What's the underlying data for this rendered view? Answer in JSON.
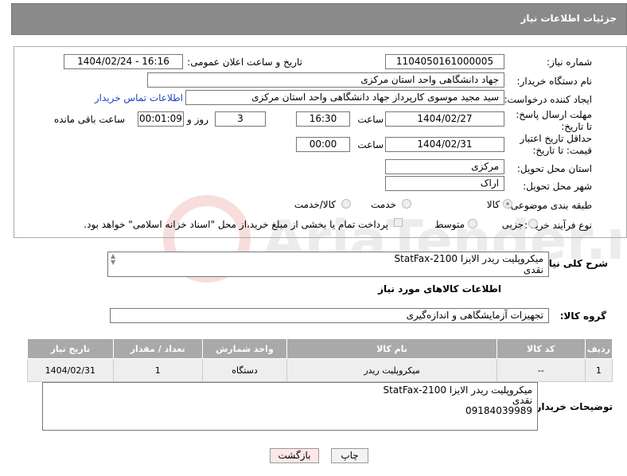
{
  "header": {
    "title": "جزئیات اطلاعات نیاز"
  },
  "form": {
    "need_number_label": "شماره نیاز:",
    "need_number": "1104050161000005",
    "announce_label": "تاریخ و ساعت اعلان عمومی:",
    "announce_value": "1404/02/24 - 16:16",
    "buyer_org_label": "نام دستگاه خریدار:",
    "buyer_org": "جهاد دانشگاهی واحد استان مرکزی",
    "creator_label": "ایجاد کننده درخواست:",
    "creator": "سید مجید  موسوی  کارپرداز جهاد دانشگاهی واحد استان مرکزی",
    "contact_link": "اطلاعات تماس خریدار",
    "reply_deadline_label": "مهلت ارسال پاسخ: تا تاریخ:",
    "reply_date": "1404/02/27",
    "time_label": "ساعت",
    "reply_time": "16:30",
    "days_value": "3",
    "days_label": "روز و",
    "remaining_time": "00:01:09",
    "remaining_label": "ساعت باقی مانده",
    "price_deadline_label": "حداقل تاریخ اعتبار قیمت: تا تاریخ:",
    "price_date": "1404/02/31",
    "price_time": "00:00",
    "province_label": "استان محل تحویل:",
    "province": "مرکزی",
    "city_label": "شهر محل تحویل:",
    "city": "اراک",
    "category_label": "طبقه بندی موضوعی:",
    "category_options": [
      "کالا",
      "خدمت",
      "کالا/خدمت"
    ],
    "process_label": "نوع فرآیند خرید :",
    "process_options": [
      "جزیی",
      "متوسط"
    ],
    "payment_note": "پرداخت تمام یا بخشی از مبلغ خرید،از محل \"اسناد خزانه اسلامی\" خواهد بود."
  },
  "description": {
    "label": "شرح کلی نیاز:",
    "text": "میکروپلیت ریدر الایزا StatFax-2100\nنقدی"
  },
  "goods": {
    "section_title": "اطلاعات کالاهای مورد نیاز",
    "group_label": "گروه کالا:",
    "group_value": "تجهیزات آزمایشگاهی و اندازه‌گیری",
    "columns": [
      "ردیف",
      "کد کالا",
      "نام کالا",
      "واحد شمارش",
      "تعداد / مقدار",
      "تاریخ نیاز"
    ],
    "rows": [
      {
        "row": "1",
        "code": "--",
        "name": "میکروپلیت ریدر",
        "unit": "دستگاه",
        "qty": "1",
        "date": "1404/02/31"
      }
    ]
  },
  "buyer_notes": {
    "label": "توضیحات خریدار:",
    "text": "میکروپلیت ریدر الایزا StatFax-2100\nنقدی\n09184039989"
  },
  "buttons": {
    "print": "چاپ",
    "back": "بازگشت"
  },
  "watermark": {
    "text": "AriaTender.neT"
  },
  "colors": {
    "header_bg": "#8a8a8a",
    "table_header_bg": "#a9a9a9",
    "link": "#1a47c4",
    "back_btn_bg": "#fde7e7"
  }
}
